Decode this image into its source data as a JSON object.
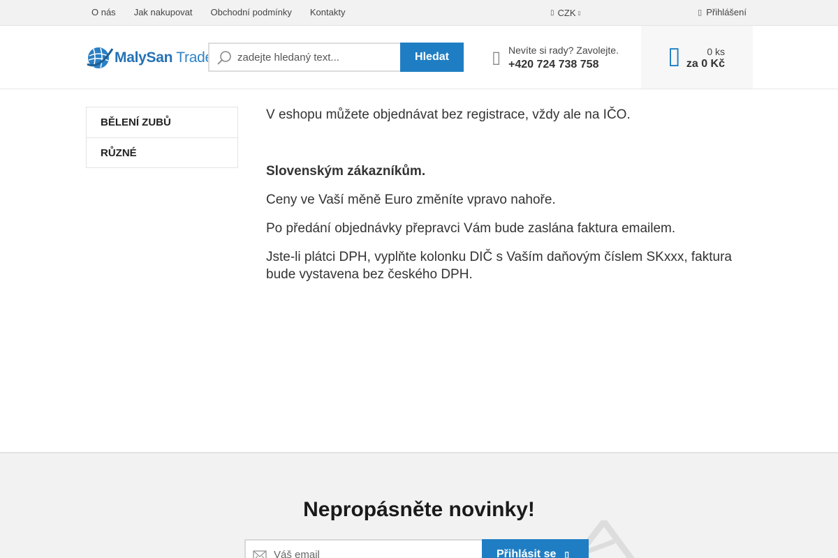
{
  "topbar": {
    "nav": [
      "O nás",
      "Jak nakupovat",
      "Obchodní podmínky",
      "Kontakty"
    ],
    "currency": "CZK",
    "login": "Přihlášení"
  },
  "logo": {
    "part1": "MalySan",
    "part2": " Trade"
  },
  "search": {
    "placeholder": "zadejte hledaný text...",
    "button": "Hledat"
  },
  "contact": {
    "line1": "Nevíte si rady? Zavolejte.",
    "phone": "+420 724 738 758"
  },
  "cart": {
    "qty": "0 ks",
    "price": "za 0 Kč"
  },
  "sidebar": {
    "items": [
      "BĚLENÍ ZUBŮ",
      "RŮZNÉ"
    ]
  },
  "content": {
    "p1": "V eshopu můžete objednávat bez registrace, vždy ale na IČO.",
    "heading": "Slovenským zákazníkům.",
    "p2": "Ceny ve Vaší měně Euro změníte vpravo nahoře.",
    "p3": "Po předání objednávky přepravci Vám bude zaslána faktura emailem.",
    "p4": "Jste-li plátci DPH, vyplňte kolonku DIČ s Vaším daňovým číslem SKxxx, faktura bude vystavena bez českého DPH."
  },
  "newsletter": {
    "title": "Nepropásněte novinky!",
    "placeholder": "Váš email",
    "button": "Přihlásit se"
  },
  "icons": {
    "search": "search-icon",
    "phone": "phone-icon",
    "cart": "cart-icon",
    "user": "user-icon",
    "currency": "currency-icon",
    "mail": "mail-icon",
    "plane": "paper-plane-icon"
  },
  "colors": {
    "accent": "#1f7ec3",
    "brand": "#2472b5"
  }
}
